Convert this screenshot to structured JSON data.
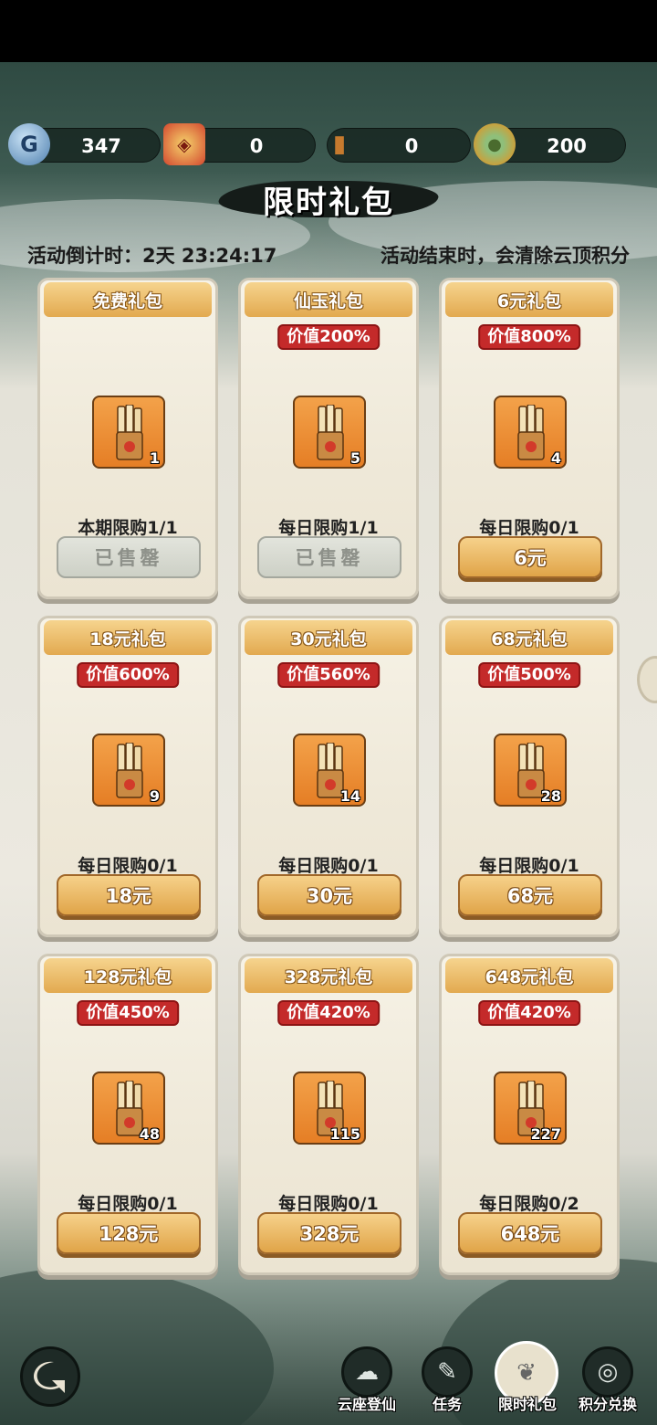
{
  "currencies": [
    {
      "icon": "spirit-coin-icon",
      "value": "347"
    },
    {
      "icon": "red-talisman-icon",
      "value": "0"
    },
    {
      "icon": "scroll-bundle-icon",
      "value": "0"
    },
    {
      "icon": "jade-coin-icon",
      "value": "200"
    }
  ],
  "title": "限时礼包",
  "countdown": "活动倒计时：2天 23:24:17",
  "end_note": "活动结束时，会清除云顶积分",
  "packs": [
    {
      "name": "免费礼包",
      "badge": "",
      "count": "1",
      "limit": "本期限购1/1",
      "button": "已售罄",
      "sold_out": true
    },
    {
      "name": "仙玉礼包",
      "badge": "价值200%",
      "count": "5",
      "limit": "每日限购1/1",
      "button": "已售罄",
      "sold_out": true
    },
    {
      "name": "6元礼包",
      "badge": "价值800%",
      "count": "4",
      "limit": "每日限购0/1",
      "button": "6元",
      "sold_out": false
    },
    {
      "name": "18元礼包",
      "badge": "价值600%",
      "count": "9",
      "limit": "每日限购0/1",
      "button": "18元",
      "sold_out": false
    },
    {
      "name": "30元礼包",
      "badge": "价值560%",
      "count": "14",
      "limit": "每日限购0/1",
      "button": "30元",
      "sold_out": false
    },
    {
      "name": "68元礼包",
      "badge": "价值500%",
      "count": "28",
      "limit": "每日限购0/1",
      "button": "68元",
      "sold_out": false
    },
    {
      "name": "128元礼包",
      "badge": "价值450%",
      "count": "48",
      "limit": "每日限购0/1",
      "button": "128元",
      "sold_out": false
    },
    {
      "name": "328元礼包",
      "badge": "价值420%",
      "count": "115",
      "limit": "每日限购0/1",
      "button": "328元",
      "sold_out": false
    },
    {
      "name": "648元礼包",
      "badge": "价值420%",
      "count": "227",
      "limit": "每日限购0/2",
      "button": "648元",
      "sold_out": false
    }
  ],
  "nav": [
    {
      "label": "云座登仙",
      "icon": "cloud-icon",
      "active": false
    },
    {
      "label": "任务",
      "icon": "scroll-icon",
      "active": false
    },
    {
      "label": "限时礼包",
      "icon": "gift-bag-icon",
      "active": true
    },
    {
      "label": "积分兑换",
      "icon": "exchange-icon",
      "active": false
    }
  ]
}
